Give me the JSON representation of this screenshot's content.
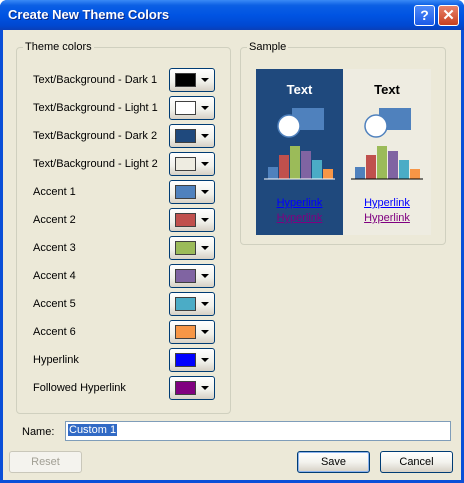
{
  "window": {
    "title": "Create New Theme Colors",
    "help_glyph": "?",
    "close_glyph": "✕"
  },
  "theme_colors": {
    "group_label": "Theme colors",
    "rows": [
      {
        "label": "Text/Background - Dark 1",
        "color": "#000000"
      },
      {
        "label": "Text/Background - Light 1",
        "color": "#ffffff"
      },
      {
        "label": "Text/Background - Dark 2",
        "color": "#1f497d"
      },
      {
        "label": "Text/Background - Light 2",
        "color": "#eeece1"
      },
      {
        "label": "Accent 1",
        "color": "#4f81bd"
      },
      {
        "label": "Accent 2",
        "color": "#c0504d"
      },
      {
        "label": "Accent 3",
        "color": "#9bbb59"
      },
      {
        "label": "Accent 4",
        "color": "#8064a2"
      },
      {
        "label": "Accent 5",
        "color": "#4bacc6"
      },
      {
        "label": "Accent 6",
        "color": "#f79646"
      },
      {
        "label": "Hyperlink",
        "color": "#0000ff"
      },
      {
        "label": "Followed Hyperlink",
        "color": "#800080"
      }
    ]
  },
  "sample": {
    "group_label": "Sample",
    "dark": {
      "text": "Text",
      "hyperlink": "Hyperlink",
      "followed_hyperlink": "Hyperlink"
    },
    "light": {
      "text": "Text",
      "hyperlink": "Hyperlink",
      "followed_hyperlink": "Hyperlink"
    }
  },
  "name": {
    "label": "Name:",
    "value": "Custom 1"
  },
  "buttons": {
    "reset": "Reset",
    "save": "Save",
    "cancel": "Cancel"
  },
  "icons": {
    "help": "help-icon",
    "close": "close-icon",
    "dropdown": "chevron-down-icon"
  }
}
